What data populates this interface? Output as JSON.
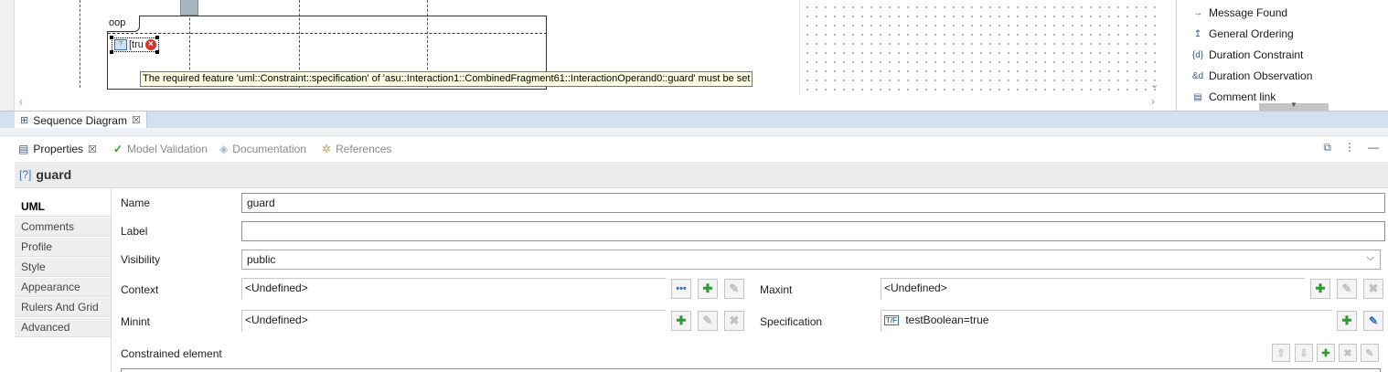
{
  "diagram": {
    "fragment_label": "oop",
    "guard_text": "[tru",
    "tooltip": "The required feature 'uml::Constraint::specification' of 'asu::Interaction1::CombinedFragment61::InteractionOperand0::guard' must be set"
  },
  "palette": {
    "items": [
      {
        "label": "Message Found",
        "icon": "message-found-icon"
      },
      {
        "label": "General Ordering",
        "icon": "general-ordering-icon"
      },
      {
        "label": "Duration Constraint",
        "icon": "duration-constraint-icon"
      },
      {
        "label": "Duration Observation",
        "icon": "duration-observation-icon"
      },
      {
        "label": "Comment link",
        "icon": "comment-link-icon"
      }
    ]
  },
  "editor": {
    "tab_label": "Sequence Diagram"
  },
  "view_tabs": [
    {
      "label": "Properties",
      "active": true
    },
    {
      "label": "Model Validation",
      "active": false
    },
    {
      "label": "Documentation",
      "active": false
    },
    {
      "label": "References",
      "active": false
    }
  ],
  "properties": {
    "title": "guard",
    "title_icon": "[?]",
    "categories": [
      "UML",
      "Comments",
      "Profile",
      "Style",
      "Appearance",
      "Rulers And Grid",
      "Advanced"
    ],
    "fields": {
      "name": {
        "label": "Name",
        "value": "guard"
      },
      "label": {
        "label": "Label",
        "value": ""
      },
      "visibility": {
        "label": "Visibility",
        "value": "public"
      },
      "context": {
        "label": "Context",
        "value": "<Undefined>"
      },
      "maxint": {
        "label": "Maxint",
        "value": "<Undefined>"
      },
      "minint": {
        "label": "Minint",
        "value": "<Undefined>"
      },
      "specification": {
        "label": "Specification",
        "value": "testBoolean=true",
        "icon_text": "T/F"
      },
      "constrained_element": {
        "label": "Constrained element"
      }
    }
  },
  "colors": {
    "tab_band": "#d3e0ef",
    "tooltip_bg": "#ffffe1",
    "add_green": "#2f9a2f",
    "error_red": "#d9342b"
  }
}
